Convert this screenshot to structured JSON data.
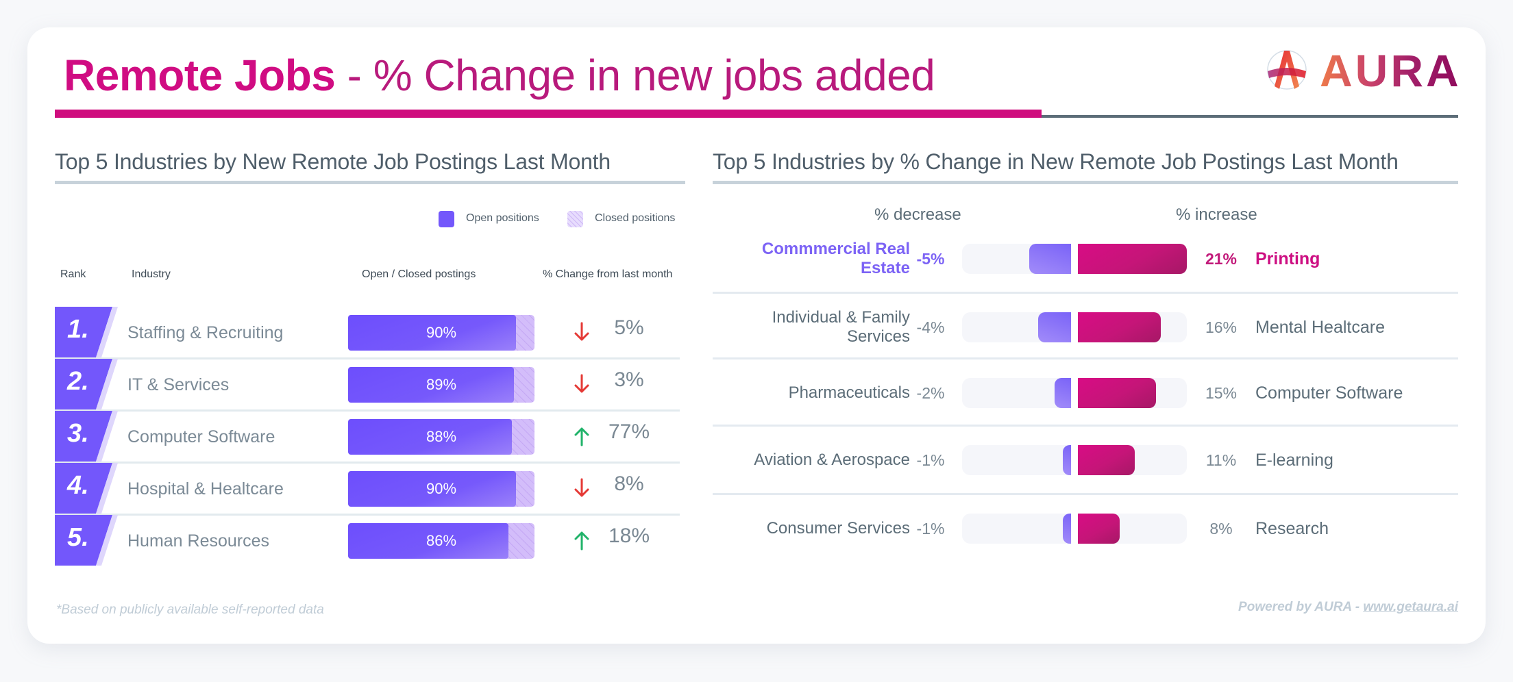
{
  "header": {
    "title_bold": "Remote Jobs",
    "title_rest": " - % Change in new jobs added",
    "logo_text": "AURA"
  },
  "colors": {
    "brand_magenta": "#cf0d7e",
    "open_positions": "#7357fb",
    "closed_positions": "#d3bdfa",
    "decrease": "#7c63f5",
    "increase": "#c81680",
    "trend_down": "#e53935",
    "trend_up": "#21b36a"
  },
  "chart_data": [
    {
      "type": "bar",
      "title": "Top 5 Industries by New Remote Job Postings Last Month",
      "legend": [
        "Open positions",
        "Closed positions"
      ],
      "legend_position": "top-right",
      "columns": [
        "Rank",
        "Industry",
        "Open / Closed postings",
        "% Change from last month"
      ],
      "rows": [
        {
          "rank": "1.",
          "industry": "Staffing & Recruiting",
          "open_pct": 90,
          "open_label": "90%",
          "trend": "down",
          "change_label": "5%"
        },
        {
          "rank": "2.",
          "industry": "IT & Services",
          "open_pct": 89,
          "open_label": "89%",
          "trend": "down",
          "change_label": "3%"
        },
        {
          "rank": "3.",
          "industry": "Computer Software",
          "open_pct": 88,
          "open_label": "88%",
          "trend": "up",
          "change_label": "77%"
        },
        {
          "rank": "4.",
          "industry": "Hospital & Healtcare",
          "open_pct": 90,
          "open_label": "90%",
          "trend": "down",
          "change_label": "8%"
        },
        {
          "rank": "5.",
          "industry": "Human Resources",
          "open_pct": 86,
          "open_label": "86%",
          "trend": "up",
          "change_label": "18%"
        }
      ]
    },
    {
      "type": "bar",
      "title": "Top 5 Industries by % Change in New Remote Job Postings Last Month",
      "decrease_label": "% decrease",
      "increase_label": "% increase",
      "scale_max": 21,
      "rows": [
        {
          "dec_industry": "Commmercial Real Estate",
          "dec_value": -5,
          "dec_label": "-5%",
          "inc_value": 21,
          "inc_label": "21%",
          "inc_industry": "Printing",
          "highlight": true
        },
        {
          "dec_industry": "Individual & Family Services",
          "dec_value": -4,
          "dec_label": "-4%",
          "inc_value": 16,
          "inc_label": "16%",
          "inc_industry": "Mental Healtcare",
          "highlight": false
        },
        {
          "dec_industry": "Pharmaceuticals",
          "dec_value": -2,
          "dec_label": "-2%",
          "inc_value": 15,
          "inc_label": "15%",
          "inc_industry": "Computer Software",
          "highlight": false
        },
        {
          "dec_industry": "Aviation & Aerospace",
          "dec_value": -1,
          "dec_label": "-1%",
          "inc_value": 11,
          "inc_label": "11%",
          "inc_industry": "E-learning",
          "highlight": false
        },
        {
          "dec_industry": "Consumer Services",
          "dec_value": -1,
          "dec_label": "-1%",
          "inc_value": 8,
          "inc_label": "8%",
          "inc_industry": "Research",
          "highlight": false
        }
      ]
    }
  ],
  "footer": {
    "footnote": "*Based on publicly available self-reported data",
    "powered_prefix": "Powered by AURA - ",
    "powered_link": "www.getaura.ai"
  }
}
